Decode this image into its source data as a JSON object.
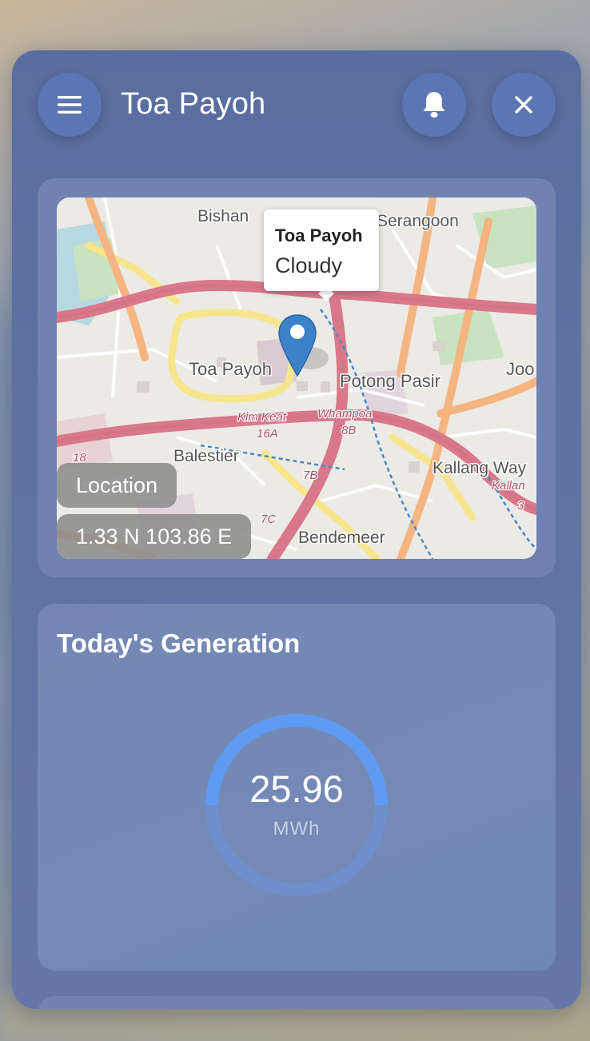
{
  "header": {
    "title": "Toa Payoh",
    "menu_icon": "hamburger-menu-icon",
    "bell_icon": "bell-icon",
    "close_icon": "close-icon"
  },
  "map": {
    "popup": {
      "name": "Toa Payoh",
      "weather": "Cloudy"
    },
    "labels": {
      "bishan": "Bishan",
      "serangoon": "Serangoon",
      "toa_payoh": "Toa Payoh",
      "potong_pasir": "Potong Pasir",
      "joo": "Joo",
      "kim_keat": "Kim Keat",
      "whampoa": "Whampoa",
      "r16a": "16A",
      "r8b": "8B",
      "r18": "18",
      "balestier": "Balestier",
      "r7b": "7B",
      "r7c": "7C",
      "kallang_way": "Kallang Way",
      "kallang": "Kallan",
      "r3": "3",
      "bendemeer": "Bendemeer"
    },
    "location_label": "Location",
    "coordinates": "1.33 N 103.86 E"
  },
  "generation": {
    "title": "Today's Generation",
    "value": "25.96",
    "unit": "MWh",
    "accent": "#5f9bf3"
  }
}
